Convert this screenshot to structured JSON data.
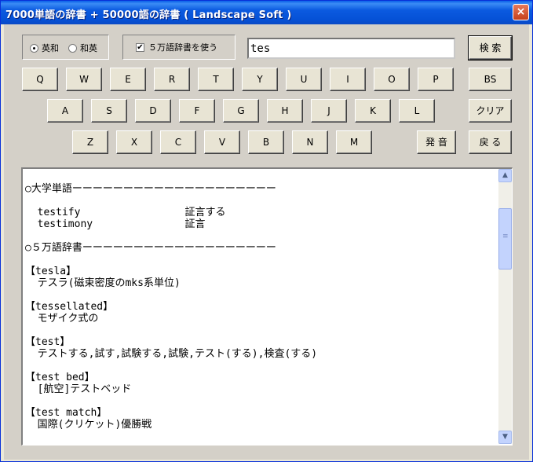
{
  "window": {
    "title": "7000単語の辞書 + 50000語の辞書 ( Landscape Soft )",
    "close_glyph": "×"
  },
  "options": {
    "radio_english": "英和",
    "radio_japanese": "和英",
    "radio_selected": "英和",
    "use_dict_label": "５万語辞書を使う",
    "use_dict_checked": true,
    "check_glyph": "✔"
  },
  "search": {
    "value": "tes",
    "button": "検 索"
  },
  "keyboard": {
    "row1": [
      "Q",
      "W",
      "E",
      "R",
      "T",
      "Y",
      "U",
      "I",
      "O",
      "P"
    ],
    "row2": [
      "A",
      "S",
      "D",
      "F",
      "G",
      "H",
      "J",
      "K",
      "L"
    ],
    "row3": [
      "Z",
      "X",
      "C",
      "V",
      "B",
      "N",
      "M"
    ]
  },
  "side_buttons": {
    "bs": "BS",
    "clear": "クリア",
    "pronounce": "発 音",
    "back": "戻 る"
  },
  "results": {
    "lines": [
      "○大学単語ーーーーーーーーーーーーーーーーーーーー",
      "",
      "  testify                 証言する",
      "  testimony               証言",
      "",
      "○５万語辞書ーーーーーーーーーーーーーーーーーーー",
      "",
      "【tesla】",
      "  テスラ(磁束密度のmks系単位)",
      "",
      "【tessellated】",
      "  モザイク式の",
      "",
      "【test】",
      "  テストする,試す,試験する,試験,テスト(する),検査(する)",
      "",
      "【test bed】",
      "  [航空]テストベッド",
      "",
      "【test match】",
      "  国際(クリケット)優勝戦"
    ]
  },
  "scrollbar": {
    "up_glyph": "▲",
    "down_glyph": "▼",
    "grip_glyph": "≡"
  }
}
